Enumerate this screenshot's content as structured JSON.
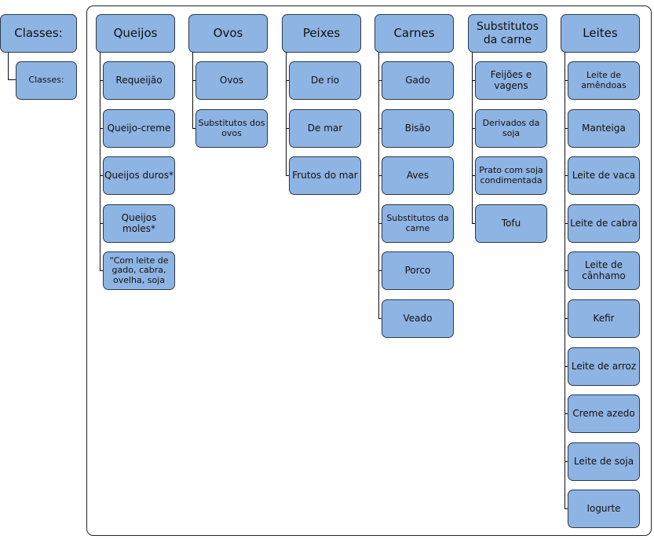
{
  "root": {
    "title": "Classes:",
    "child": "Classes:"
  },
  "columns": [
    {
      "title": "Queijos",
      "items": [
        "Requeijão",
        "Queijo-creme",
        "Queijos duros*",
        "Queijos moles*",
        "“Com leite de gado, cabra, ovelha, soja"
      ]
    },
    {
      "title": "Ovos",
      "items": [
        "Ovos",
        "Substitutos dos ovos"
      ]
    },
    {
      "title": "Peixes",
      "items": [
        "De rio",
        "De mar",
        "Frutos do mar"
      ]
    },
    {
      "title": "Carnes",
      "items": [
        "Gado",
        "Bisão",
        "Aves",
        "Substitutos da carne",
        "Porco",
        "Veado"
      ]
    },
    {
      "title": "Substitutos da carne",
      "items": [
        "Feijões e vagens",
        "Derivados da soja",
        "Prato com soja condimentada",
        "Tofu"
      ]
    },
    {
      "title": "Leites",
      "items": [
        "Leite de amêndoas",
        "Manteiga",
        "Leite de vaca",
        "Leite de cabra",
        "Leite de cânhamo",
        "Kefir",
        "Leite de arroz",
        "Creme azedo",
        "Leite de soja",
        "Iogurte"
      ]
    }
  ],
  "colors": {
    "box_fill": "#8eb4e3",
    "box_border": "#2b3a4c"
  }
}
